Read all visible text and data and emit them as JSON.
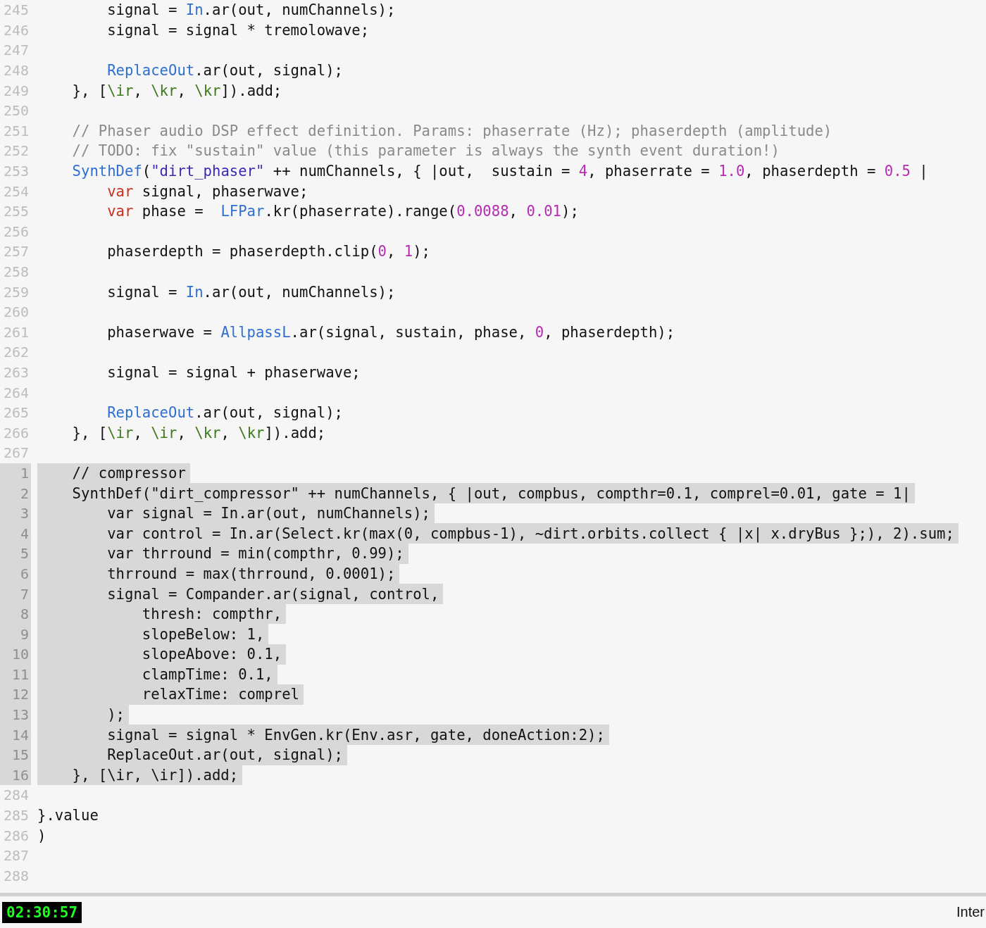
{
  "editor": {
    "lines": [
      {
        "number": "245",
        "selected": false,
        "tokens": [
          {
            "kind": "plain",
            "text": "        signal = "
          },
          {
            "kind": "class",
            "text": "In"
          },
          {
            "kind": "plain",
            "text": ".ar(out, numChannels);"
          }
        ]
      },
      {
        "number": "246",
        "selected": false,
        "tokens": [
          {
            "kind": "plain",
            "text": "        signal = signal * tremolowave;"
          }
        ]
      },
      {
        "number": "247",
        "selected": false
      },
      {
        "number": "248",
        "selected": false,
        "tokens": [
          {
            "kind": "class",
            "text": "        ReplaceOut"
          },
          {
            "kind": "plain",
            "text": ".ar(out, signal);"
          }
        ]
      },
      {
        "number": "249",
        "selected": false,
        "tokens": [
          {
            "kind": "plain",
            "text": "    }, ["
          },
          {
            "kind": "symbol",
            "text": "\\ir"
          },
          {
            "kind": "plain",
            "text": ", "
          },
          {
            "kind": "symbol",
            "text": "\\kr"
          },
          {
            "kind": "plain",
            "text": ", "
          },
          {
            "kind": "symbol",
            "text": "\\kr"
          },
          {
            "kind": "plain",
            "text": "]).add;"
          }
        ]
      },
      {
        "number": "250",
        "selected": false
      },
      {
        "number": "251",
        "selected": false,
        "tokens": [
          {
            "kind": "comment",
            "text": "    // Phaser audio DSP effect definition. Params: phaserrate (Hz); phaserdepth (amplitude)"
          }
        ]
      },
      {
        "number": "252",
        "selected": false,
        "tokens": [
          {
            "kind": "comment",
            "text": "    // TODO: fix \"sustain\" value (this parameter is always the synth event duration!)"
          }
        ]
      },
      {
        "number": "253",
        "selected": false,
        "tokens": [
          {
            "kind": "class",
            "text": "    SynthDef"
          },
          {
            "kind": "plain",
            "text": "("
          },
          {
            "kind": "string",
            "text": "\"dirt_phaser\""
          },
          {
            "kind": "plain",
            "text": " ++ numChannels, { |out,  sustain = "
          },
          {
            "kind": "number",
            "text": "4"
          },
          {
            "kind": "plain",
            "text": ", phaserrate = "
          },
          {
            "kind": "number",
            "text": "1.0"
          },
          {
            "kind": "plain",
            "text": ", phaserdepth = "
          },
          {
            "kind": "number",
            "text": "0.5"
          },
          {
            "kind": "plain",
            "text": " |"
          }
        ]
      },
      {
        "number": "254",
        "selected": false,
        "tokens": [
          {
            "kind": "keyword",
            "text": "        var"
          },
          {
            "kind": "plain",
            "text": " signal, phaserwave;"
          }
        ]
      },
      {
        "number": "255",
        "selected": false,
        "tokens": [
          {
            "kind": "keyword",
            "text": "        var"
          },
          {
            "kind": "plain",
            "text": " phase =  "
          },
          {
            "kind": "class",
            "text": "LFPar"
          },
          {
            "kind": "plain",
            "text": ".kr(phaserrate).range("
          },
          {
            "kind": "number",
            "text": "0.0088"
          },
          {
            "kind": "plain",
            "text": ", "
          },
          {
            "kind": "number",
            "text": "0.01"
          },
          {
            "kind": "plain",
            "text": ");"
          }
        ]
      },
      {
        "number": "256",
        "selected": false
      },
      {
        "number": "257",
        "selected": false,
        "tokens": [
          {
            "kind": "plain",
            "text": "        phaserdepth = phaserdepth.clip("
          },
          {
            "kind": "number",
            "text": "0"
          },
          {
            "kind": "plain",
            "text": ", "
          },
          {
            "kind": "number",
            "text": "1"
          },
          {
            "kind": "plain",
            "text": ");"
          }
        ]
      },
      {
        "number": "258",
        "selected": false
      },
      {
        "number": "259",
        "selected": false,
        "tokens": [
          {
            "kind": "plain",
            "text": "        signal = "
          },
          {
            "kind": "class",
            "text": "In"
          },
          {
            "kind": "plain",
            "text": ".ar(out, numChannels);"
          }
        ]
      },
      {
        "number": "260",
        "selected": false
      },
      {
        "number": "261",
        "selected": false,
        "tokens": [
          {
            "kind": "plain",
            "text": "        phaserwave = "
          },
          {
            "kind": "class",
            "text": "AllpassL"
          },
          {
            "kind": "plain",
            "text": ".ar(signal, sustain, phase, "
          },
          {
            "kind": "number",
            "text": "0"
          },
          {
            "kind": "plain",
            "text": ", phaserdepth);"
          }
        ]
      },
      {
        "number": "262",
        "selected": false
      },
      {
        "number": "263",
        "selected": false,
        "tokens": [
          {
            "kind": "plain",
            "text": "        signal = signal + phaserwave;"
          }
        ]
      },
      {
        "number": "264",
        "selected": false
      },
      {
        "number": "265",
        "selected": false,
        "tokens": [
          {
            "kind": "class",
            "text": "        ReplaceOut"
          },
          {
            "kind": "plain",
            "text": ".ar(out, signal);"
          }
        ]
      },
      {
        "number": "266",
        "selected": false,
        "tokens": [
          {
            "kind": "plain",
            "text": "    }, ["
          },
          {
            "kind": "symbol",
            "text": "\\ir"
          },
          {
            "kind": "plain",
            "text": ", "
          },
          {
            "kind": "symbol",
            "text": "\\ir"
          },
          {
            "kind": "plain",
            "text": ", "
          },
          {
            "kind": "symbol",
            "text": "\\kr"
          },
          {
            "kind": "plain",
            "text": ", "
          },
          {
            "kind": "symbol",
            "text": "\\kr"
          },
          {
            "kind": "plain",
            "text": "]).add;"
          }
        ]
      },
      {
        "number": "267",
        "selected": false
      },
      {
        "number": "1",
        "selected": true,
        "tokens": [
          {
            "kind": "plain",
            "text": "    // compressor"
          }
        ]
      },
      {
        "number": "2",
        "selected": true,
        "tokens": [
          {
            "kind": "plain",
            "text": "    SynthDef(\"dirt_compressor\" ++ numChannels, { |out, compbus, compthr=0.1, comprel=0.01, gate = 1|"
          }
        ]
      },
      {
        "number": "3",
        "selected": true,
        "tokens": [
          {
            "kind": "plain",
            "text": "        var signal = In.ar(out, numChannels);"
          }
        ]
      },
      {
        "number": "4",
        "selected": true,
        "tokens": [
          {
            "kind": "plain",
            "text": "        var control = In.ar(Select.kr(max(0, compbus-1), ~dirt.orbits.collect { |x| x.dryBus };), 2).sum;"
          }
        ]
      },
      {
        "number": "5",
        "selected": true,
        "tokens": [
          {
            "kind": "plain",
            "text": "        var thrround = min(compthr, 0.99);"
          }
        ]
      },
      {
        "number": "6",
        "selected": true,
        "tokens": [
          {
            "kind": "plain",
            "text": "        thrround = max(thrround, 0.0001);"
          }
        ]
      },
      {
        "number": "7",
        "selected": true,
        "tokens": [
          {
            "kind": "plain",
            "text": "        signal = Compander.ar(signal, control,"
          }
        ]
      },
      {
        "number": "8",
        "selected": true,
        "tokens": [
          {
            "kind": "plain",
            "text": "            thresh: compthr,"
          }
        ]
      },
      {
        "number": "9",
        "selected": true,
        "tokens": [
          {
            "kind": "plain",
            "text": "            slopeBelow: 1,"
          }
        ]
      },
      {
        "number": "10",
        "selected": true,
        "tokens": [
          {
            "kind": "plain",
            "text": "            slopeAbove: 0.1,"
          }
        ]
      },
      {
        "number": "11",
        "selected": true,
        "tokens": [
          {
            "kind": "plain",
            "text": "            clampTime: 0.1,"
          }
        ]
      },
      {
        "number": "12",
        "selected": true,
        "tokens": [
          {
            "kind": "plain",
            "text": "            relaxTime: comprel"
          }
        ]
      },
      {
        "number": "13",
        "selected": true,
        "tokens": [
          {
            "kind": "plain",
            "text": "        );"
          }
        ]
      },
      {
        "number": "14",
        "selected": true,
        "tokens": [
          {
            "kind": "plain",
            "text": "        signal = signal * EnvGen.kr(Env.asr, gate, doneAction:2);"
          }
        ]
      },
      {
        "number": "15",
        "selected": true,
        "tokens": [
          {
            "kind": "plain",
            "text": "        ReplaceOut.ar(out, signal);"
          }
        ]
      },
      {
        "number": "16",
        "selected": true,
        "tokens": [
          {
            "kind": "plain",
            "text": "    }, [\\ir, \\ir]).add;"
          }
        ]
      },
      {
        "number": "284",
        "selected": false
      },
      {
        "number": "285",
        "selected": false,
        "tokens": [
          {
            "kind": "plain",
            "text": "}.value"
          }
        ]
      },
      {
        "number": "286",
        "selected": false,
        "tokens": [
          {
            "kind": "plain",
            "text": ")"
          }
        ]
      },
      {
        "number": "287",
        "selected": false
      },
      {
        "number": "288",
        "selected": false
      }
    ]
  },
  "status_bar": {
    "clock": "02:30:57",
    "mode": "Inter"
  }
}
